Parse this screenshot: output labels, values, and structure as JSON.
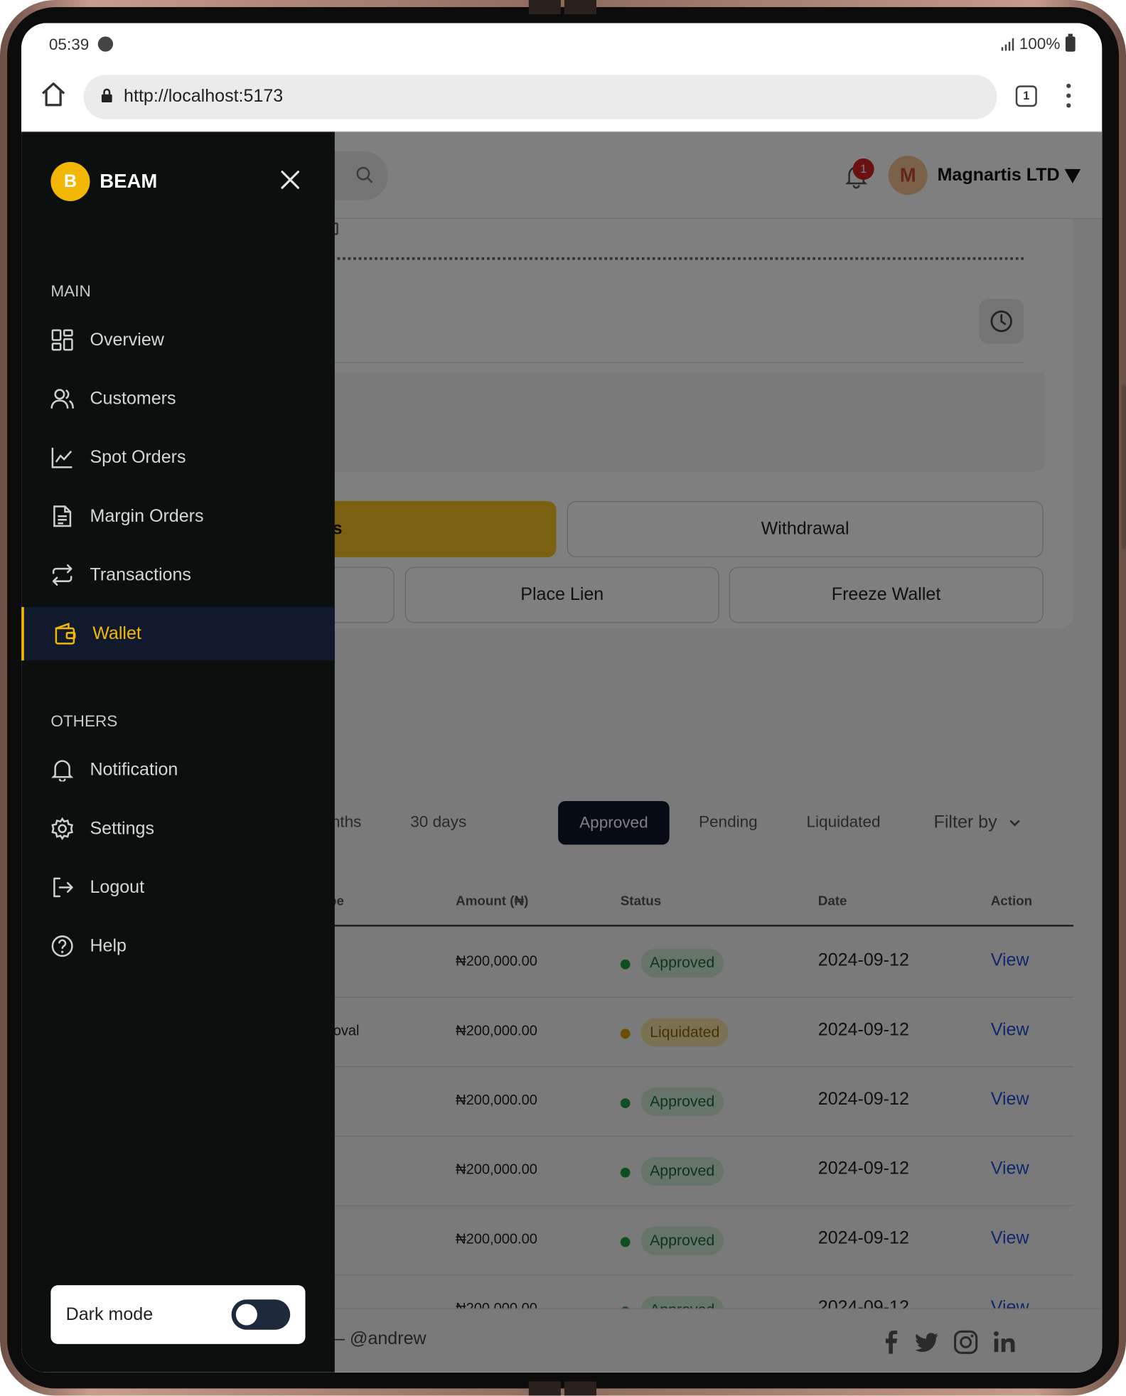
{
  "status_bar": {
    "time": "05:39",
    "battery": "100%"
  },
  "browser": {
    "url": "http://localhost:5173",
    "tab_count": "1"
  },
  "topbar": {
    "notification_count": "1",
    "avatar_letter": "M",
    "org_name": "Magnartis LTD"
  },
  "actions": {
    "fund_partial": "nds",
    "withdrawal": "Withdrawal",
    "place_lien": "Place Lien",
    "freeze_wallet": "Freeze Wallet"
  },
  "filters": {
    "months_partial": "nths",
    "days30": "30 days",
    "approved": "Approved",
    "pending": "Pending",
    "liquidated": "Liquidated",
    "filter_by": "Filter by"
  },
  "table": {
    "headers": {
      "type_partial": "pe",
      "amount": "Amount (₦)",
      "status": "Status",
      "date": "Date",
      "action": "Action"
    },
    "rows": [
      {
        "type": "",
        "amount": "₦200,000.00",
        "status": "Approved",
        "date": "2024-09-12",
        "action": "View"
      },
      {
        "type": "roval",
        "amount": "₦200,000.00",
        "status": "Liquidated",
        "date": "2024-09-12",
        "action": "View"
      },
      {
        "type": "",
        "amount": "₦200,000.00",
        "status": "Approved",
        "date": "2024-09-12",
        "action": "View"
      },
      {
        "type": "",
        "amount": "₦200,000.00",
        "status": "Approved",
        "date": "2024-09-12",
        "action": "View"
      },
      {
        "type": "",
        "amount": "₦200,000.00",
        "status": "Approved",
        "date": "2024-09-12",
        "action": "View"
      },
      {
        "type": "",
        "amount": "₦200,000.00",
        "status": "Approved",
        "date": "2024-09-12",
        "action": "View"
      }
    ]
  },
  "footer": {
    "text_partial": "dpal — @andrew"
  },
  "sidebar": {
    "brand_letter": "B",
    "brand_name": "BEAM",
    "main_label": "MAIN",
    "others_label": "OTHERS",
    "main_items": [
      {
        "label": "Overview",
        "icon": "grid-icon"
      },
      {
        "label": "Customers",
        "icon": "users-icon"
      },
      {
        "label": "Spot Orders",
        "icon": "chart-line-icon"
      },
      {
        "label": "Margin Orders",
        "icon": "document-icon"
      },
      {
        "label": "Transactions",
        "icon": "arrows-swap-icon"
      },
      {
        "label": "Wallet",
        "icon": "wallet-icon",
        "active": true
      }
    ],
    "other_items": [
      {
        "label": "Notification",
        "icon": "bell-icon"
      },
      {
        "label": "Settings",
        "icon": "gear-icon"
      },
      {
        "label": "Logout",
        "icon": "logout-icon"
      },
      {
        "label": "Help",
        "icon": "help-icon"
      }
    ],
    "dark_mode_label": "Dark mode",
    "dark_mode_on": false
  },
  "colors": {
    "accent": "#f2b705",
    "sidebar_bg": "#0b0f0d",
    "active_bg": "#111a2c",
    "link": "#1f4fd6",
    "approved": "#1f9d3a",
    "liquidated": "#d89b00"
  }
}
